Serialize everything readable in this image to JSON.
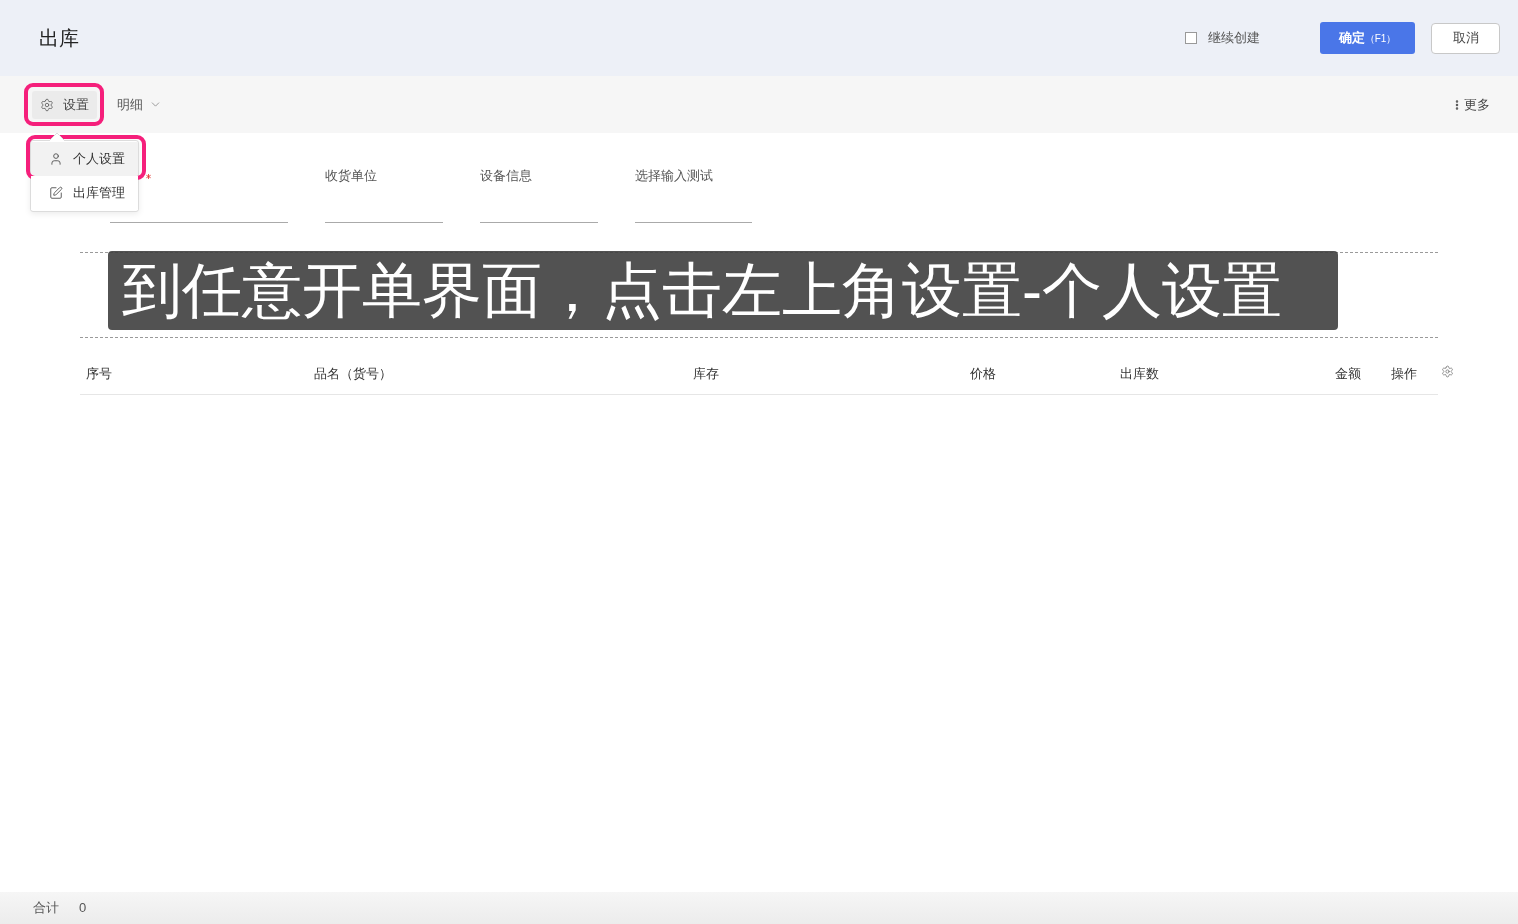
{
  "header": {
    "title": "出库",
    "continue_create": {
      "label": "继续创建",
      "checked": false
    },
    "confirm_button": {
      "label": "确定",
      "shortcut": "（F1）"
    },
    "cancel_button": {
      "label": "取消"
    }
  },
  "toolbar": {
    "settings": {
      "label": "设置",
      "highlighted": true
    },
    "detail": {
      "label": "明细"
    },
    "more": {
      "label": "更多"
    }
  },
  "settings_menu": {
    "items": [
      {
        "kind": "user",
        "label": "个人设置",
        "highlighted": true
      },
      {
        "kind": "edit",
        "label": "出库管理",
        "highlighted": false
      }
    ]
  },
  "form": {
    "fields": [
      {
        "required": true
      },
      {
        "label": "收货单位",
        "required": false
      },
      {
        "label": "设备信息",
        "required": false
      },
      {
        "label": "选择输入测试",
        "required": false
      }
    ]
  },
  "caption": "到任意开单界面，点击左上角设置-个人设置",
  "table": {
    "columns": [
      "序号",
      "品名（货号）",
      "库存",
      "价格",
      "出库数",
      "金额",
      "操作"
    ]
  },
  "footer": {
    "total_label": "合计",
    "total_value": "0"
  }
}
